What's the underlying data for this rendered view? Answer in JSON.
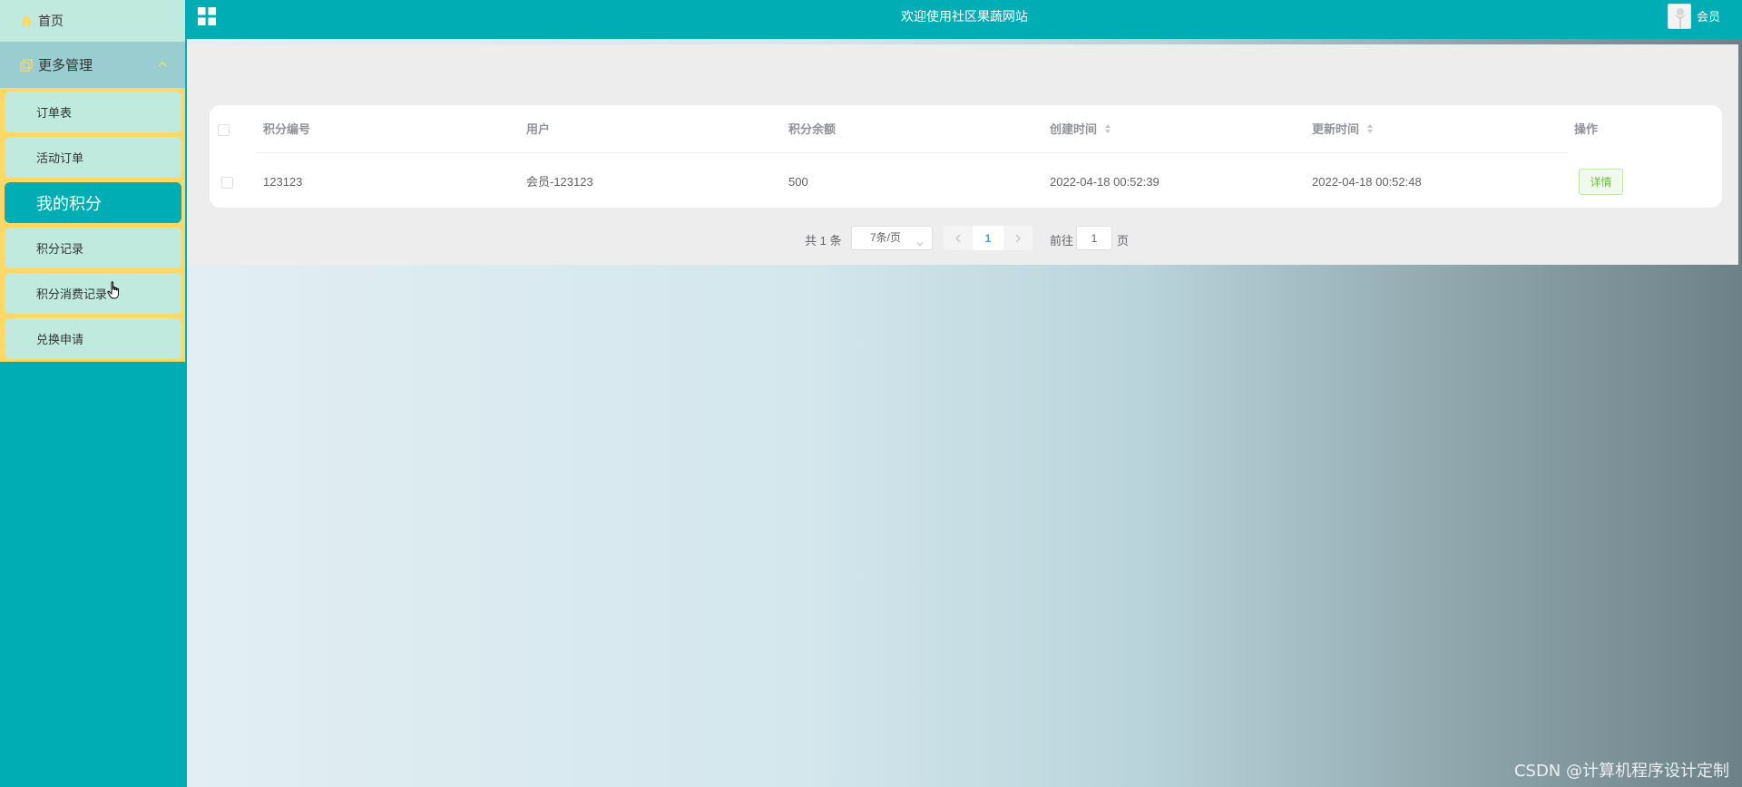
{
  "sidebar": {
    "home_label": "首页",
    "group_label": "更多管理",
    "items": [
      {
        "label": "订单表"
      },
      {
        "label": "活动订单"
      },
      {
        "label": "我的积分"
      },
      {
        "label": "积分记录"
      },
      {
        "label": "积分消费记录"
      },
      {
        "label": "兑换申请"
      }
    ]
  },
  "header": {
    "title": "欢迎使用社区果蔬网站",
    "role": "会员"
  },
  "table": {
    "columns": [
      "积分编号",
      "用户",
      "积分余额",
      "创建时间",
      "更新时间",
      "操作"
    ],
    "rows": [
      {
        "cells": [
          "123123",
          "会员-123123",
          "500",
          "2022-04-18 00:52:39",
          "2022-04-18 00:52:48"
        ],
        "action": "详情"
      }
    ]
  },
  "pagination": {
    "total_text": "共 1 条",
    "page_size": "7条/页",
    "current_page": "1",
    "goto_label": "前往",
    "goto_value": "1",
    "goto_unit": "页"
  },
  "watermark": "CSDN @计算机程序设计定制",
  "colors": {
    "primary": "#00adb5",
    "menu_item": "#bfeadd",
    "submenu_border": "#ffd867",
    "group_head": "#99cdd0"
  }
}
